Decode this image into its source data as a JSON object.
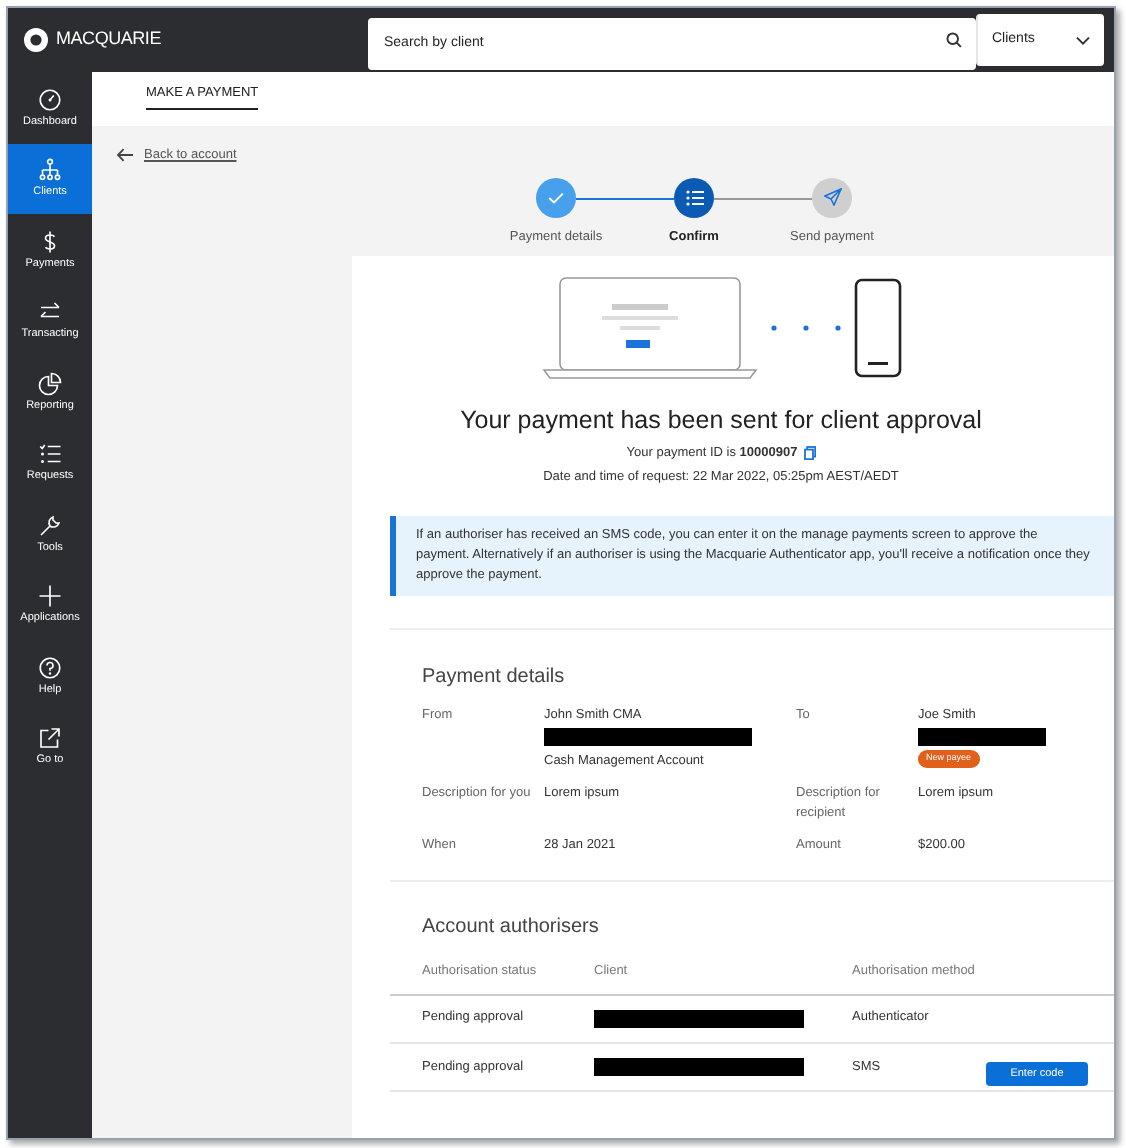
{
  "header": {
    "logo": "MACQUARIE",
    "search": {
      "placeholder": "Search by client"
    },
    "scope_select": {
      "value": "Clients"
    }
  },
  "sidebar": {
    "items": [
      {
        "label": "Dashboard",
        "selected": false
      },
      {
        "label": "Clients",
        "selected": true
      },
      {
        "label": "Payments",
        "selected": false
      },
      {
        "label": "Transacting",
        "selected": false
      },
      {
        "label": "Reporting",
        "selected": false
      },
      {
        "label": "Requests",
        "selected": false
      },
      {
        "label": "Tools",
        "selected": false
      },
      {
        "label": "Applications",
        "selected": false
      },
      {
        "label": "Help",
        "selected": false
      },
      {
        "label": "Go to",
        "selected": false
      }
    ]
  },
  "page_tabs": [
    {
      "label": "MAKE A PAYMENT",
      "selected": true
    }
  ],
  "back_link": "Back to account",
  "stepper": [
    {
      "label": "Payment details",
      "completed": true,
      "selected": false
    },
    {
      "label": "Confirm",
      "completed": false,
      "selected": true
    },
    {
      "label": "Send payment",
      "completed": false,
      "selected": false
    }
  ],
  "confirmation": {
    "title": "Your payment has been sent for client approval",
    "payment_id": "Your payment ID is **10000907**",
    "request_time": "Date and time of request: 22 Mar 2022, 05:25pm AEST/AEDT"
  },
  "notice": "If an authoriser has received an SMS code, you can enter it on the manage payments screen to approve the payment. Alternatively if an authoriser is using the Macquarie Authenticator app, you'll receive a notification once they approve the payment.",
  "payment_details": {
    "title": "Payment details",
    "fields": [
      {
        "label": "From",
        "value": "John Smith CMA",
        "redacted": true,
        "subtext": "Cash Management Account"
      },
      {
        "label": "To",
        "value": "Joe Smith",
        "redacted": true,
        "badge": "New payee"
      },
      {
        "label": "Description for you",
        "value": "Lorem ipsum"
      },
      {
        "label": "Description for recipient",
        "value": "Lorem ipsum"
      },
      {
        "label": "When",
        "value": "28 Jan 2021"
      },
      {
        "label": "Amount",
        "value": "$200.00"
      }
    ]
  },
  "authorisers": {
    "title": "Account authorisers",
    "columns": [
      "Authorisation status",
      "Client",
      "Authorisation method"
    ],
    "rows": [
      {
        "status": "Pending approval",
        "client_redacted": true,
        "method": "Authenticator"
      },
      {
        "status": "Pending approval",
        "client_redacted": true,
        "method": "SMS",
        "action": "Enter code"
      }
    ]
  }
}
